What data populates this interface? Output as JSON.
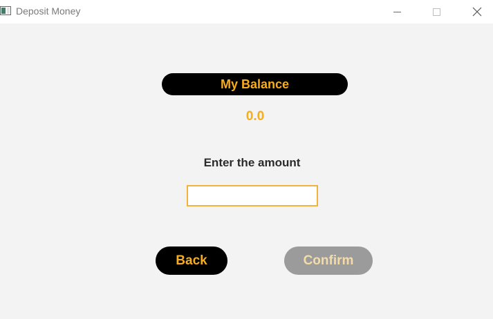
{
  "window": {
    "title": "Deposit Money",
    "controls": {
      "minimize_icon": "minimize-icon",
      "maximize_icon": "maximize-icon",
      "close_icon": "close-icon"
    }
  },
  "balance": {
    "label": "My Balance",
    "value": "0.0"
  },
  "amount": {
    "label": "Enter the amount",
    "value": "",
    "placeholder": ""
  },
  "buttons": {
    "back": "Back",
    "confirm": "Confirm"
  },
  "colors": {
    "accent": "#f7ad1c",
    "dark": "#000000",
    "disabled": "#9b9b9b",
    "background": "#f3f3f3"
  }
}
